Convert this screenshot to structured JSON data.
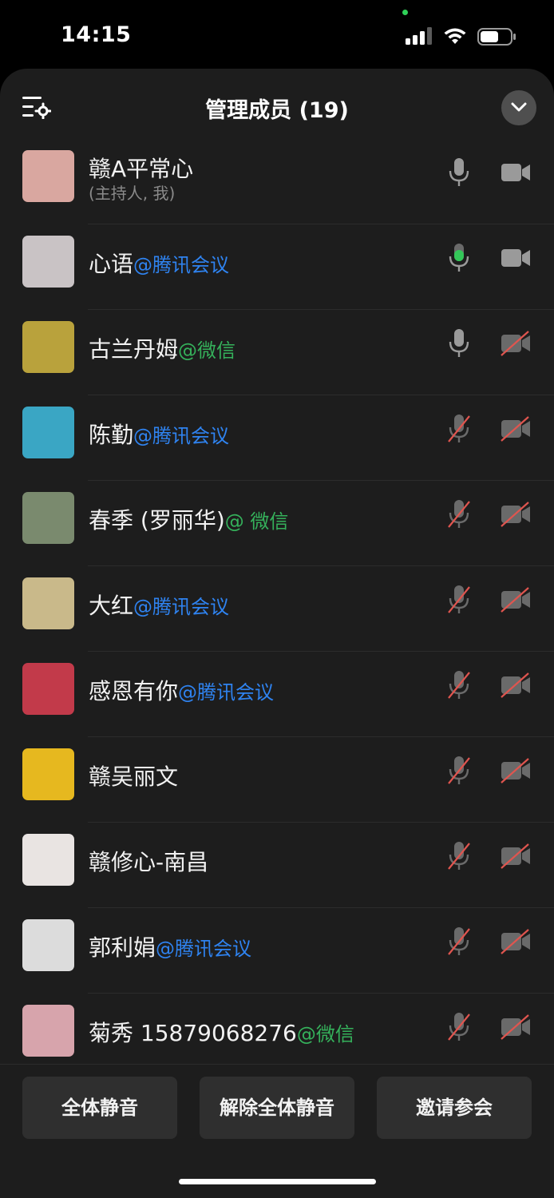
{
  "status_bar": {
    "time": "14:15"
  },
  "header": {
    "title": "管理成员 (19)"
  },
  "members": [
    {
      "name": "赣A平常心",
      "tag": "",
      "tag_color": "",
      "subtitle": "(主持人, 我)",
      "mic": "on",
      "cam": "on",
      "avatar_color": "#d9a7a0"
    },
    {
      "name": "心语",
      "tag": "@腾讯会议",
      "tag_color": "blue",
      "subtitle": "",
      "mic": "active",
      "cam": "on",
      "avatar_color": "#c9c3c5"
    },
    {
      "name": "古兰丹姆",
      "tag": "@微信",
      "tag_color": "green",
      "subtitle": "",
      "mic": "on",
      "cam": "off",
      "avatar_color": "#b9a23c"
    },
    {
      "name": "陈勤",
      "tag": "@腾讯会议",
      "tag_color": "blue",
      "subtitle": "",
      "mic": "off",
      "cam": "off",
      "avatar_color": "#3aa6c4"
    },
    {
      "name": "春季 (罗丽华)",
      "tag": "@ 微信",
      "tag_color": "green",
      "subtitle": "",
      "mic": "off",
      "cam": "off",
      "avatar_color": "#7a8a6e"
    },
    {
      "name": "大红",
      "tag": "@腾讯会议",
      "tag_color": "blue",
      "subtitle": "",
      "mic": "off",
      "cam": "off",
      "avatar_color": "#c9b98a"
    },
    {
      "name": "感恩有你",
      "tag": "@腾讯会议",
      "tag_color": "blue",
      "subtitle": "",
      "mic": "off",
      "cam": "off",
      "avatar_color": "#c23a4a"
    },
    {
      "name": "赣吴丽文",
      "tag": "",
      "tag_color": "",
      "subtitle": "",
      "mic": "off",
      "cam": "off",
      "avatar_color": "#e6b81f"
    },
    {
      "name": "赣修心-南昌",
      "tag": "",
      "tag_color": "",
      "subtitle": "",
      "mic": "off",
      "cam": "off",
      "avatar_color": "#e9e4e2"
    },
    {
      "name": "郭利娟",
      "tag": "@腾讯会议",
      "tag_color": "blue",
      "subtitle": "",
      "mic": "off",
      "cam": "off",
      "avatar_color": "#dcdcdc"
    },
    {
      "name": "菊秀 15879068276",
      "tag": "@微信",
      "tag_color": "green",
      "subtitle": "",
      "mic": "off",
      "cam": "off",
      "avatar_color": "#d7a4ac"
    }
  ],
  "actions": {
    "mute_all": "全体静音",
    "unmute_all": "解除全体静音",
    "invite": "邀请参会"
  },
  "colors": {
    "tag_blue": "#2f83f0",
    "tag_green": "#35b15b",
    "mic_active": "#34c759",
    "muted_red": "#e0554f"
  }
}
